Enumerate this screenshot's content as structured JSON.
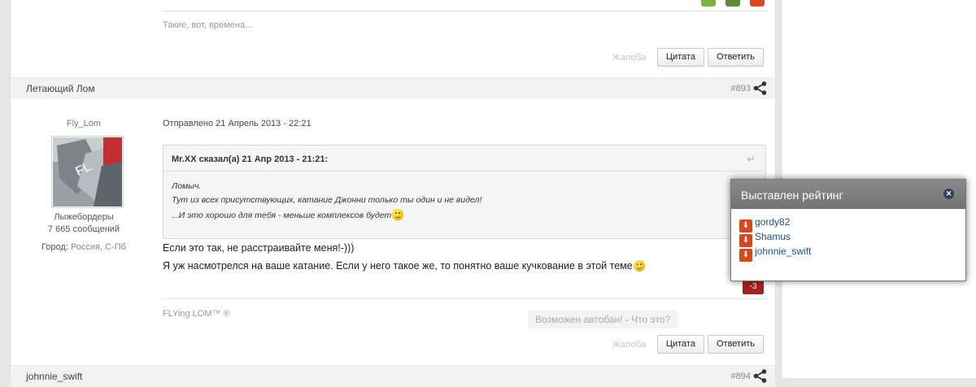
{
  "prev_post": {
    "signature": "Такие, вот, времена...",
    "vote_colors": [
      "#7db33b",
      "#5b8a3a",
      "#d84a1e"
    ],
    "actions": {
      "report": "Жалоба",
      "quote": "Цитата",
      "reply": "Ответить"
    }
  },
  "post": {
    "author": "Летающий Лом",
    "number": "#893",
    "username": "Fly_Lom",
    "group": "Лыжебордеры",
    "post_count": "7 665 сообщений",
    "city_label": "Город:",
    "city": "Россия, С-Пб",
    "posted": "Отправлено 21 Апрель 2013 - 22:21",
    "quote": {
      "cite": "Mr.XX сказал(а) 21 Апр 2013 - 21:21:",
      "lines": [
        "Ломыч.",
        "Тут из всех присутствующих, катание Джонни только ты один и не видел!",
        "...И это хорошо для тебя - меньше комплексов будет"
      ]
    },
    "text_lines": [
      "Если это так, не расстраивайте меня!-)))",
      "Я уж насмотрелся на ваше катание. Если у него такое же, то понятно ваше кучкование в этой теме"
    ],
    "rating": "-3",
    "signature": "FLYing LOM™ ®",
    "autoban": "Возможен автобан! - Что это?",
    "actions": {
      "report": "Жалоба",
      "quote": "Цитата",
      "reply": "Ответить"
    }
  },
  "next_post": {
    "author": "johnnie_swift",
    "number": "#894"
  },
  "rating_popup": {
    "title": "Выставлен рейтинг",
    "voters": [
      "gordy82",
      "Shamus",
      "johnnie_swift"
    ]
  }
}
